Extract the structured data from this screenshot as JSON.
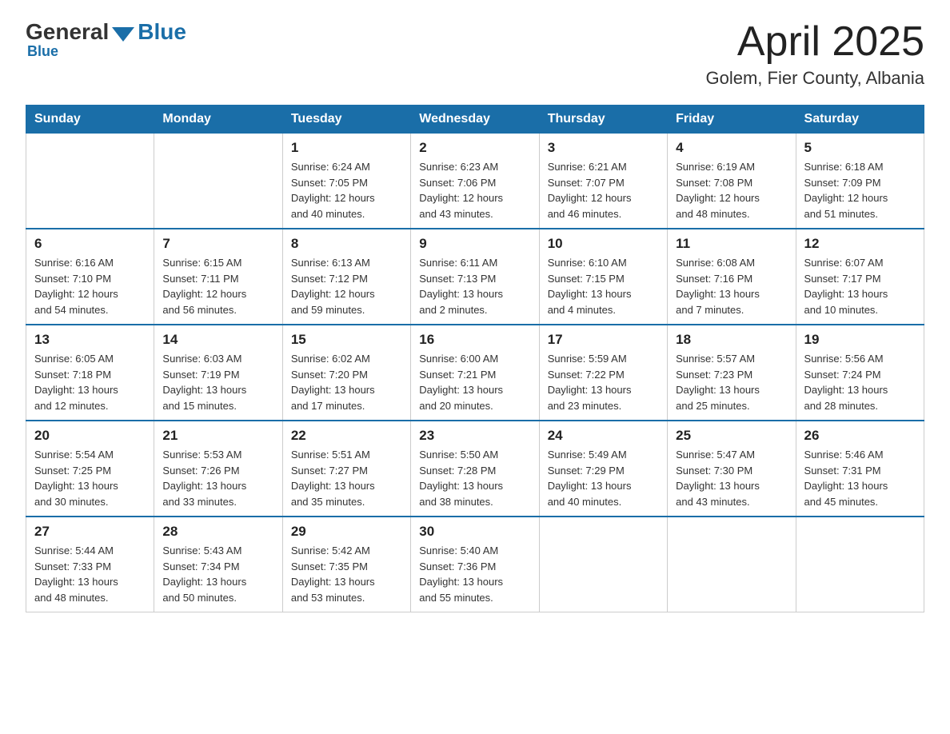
{
  "header": {
    "logo": {
      "general": "General",
      "blue": "Blue"
    },
    "title": "April 2025",
    "location": "Golem, Fier County, Albania"
  },
  "weekdays": [
    "Sunday",
    "Monday",
    "Tuesday",
    "Wednesday",
    "Thursday",
    "Friday",
    "Saturday"
  ],
  "weeks": [
    [
      {
        "day": "",
        "info": ""
      },
      {
        "day": "",
        "info": ""
      },
      {
        "day": "1",
        "info": "Sunrise: 6:24 AM\nSunset: 7:05 PM\nDaylight: 12 hours\nand 40 minutes."
      },
      {
        "day": "2",
        "info": "Sunrise: 6:23 AM\nSunset: 7:06 PM\nDaylight: 12 hours\nand 43 minutes."
      },
      {
        "day": "3",
        "info": "Sunrise: 6:21 AM\nSunset: 7:07 PM\nDaylight: 12 hours\nand 46 minutes."
      },
      {
        "day": "4",
        "info": "Sunrise: 6:19 AM\nSunset: 7:08 PM\nDaylight: 12 hours\nand 48 minutes."
      },
      {
        "day": "5",
        "info": "Sunrise: 6:18 AM\nSunset: 7:09 PM\nDaylight: 12 hours\nand 51 minutes."
      }
    ],
    [
      {
        "day": "6",
        "info": "Sunrise: 6:16 AM\nSunset: 7:10 PM\nDaylight: 12 hours\nand 54 minutes."
      },
      {
        "day": "7",
        "info": "Sunrise: 6:15 AM\nSunset: 7:11 PM\nDaylight: 12 hours\nand 56 minutes."
      },
      {
        "day": "8",
        "info": "Sunrise: 6:13 AM\nSunset: 7:12 PM\nDaylight: 12 hours\nand 59 minutes."
      },
      {
        "day": "9",
        "info": "Sunrise: 6:11 AM\nSunset: 7:13 PM\nDaylight: 13 hours\nand 2 minutes."
      },
      {
        "day": "10",
        "info": "Sunrise: 6:10 AM\nSunset: 7:15 PM\nDaylight: 13 hours\nand 4 minutes."
      },
      {
        "day": "11",
        "info": "Sunrise: 6:08 AM\nSunset: 7:16 PM\nDaylight: 13 hours\nand 7 minutes."
      },
      {
        "day": "12",
        "info": "Sunrise: 6:07 AM\nSunset: 7:17 PM\nDaylight: 13 hours\nand 10 minutes."
      }
    ],
    [
      {
        "day": "13",
        "info": "Sunrise: 6:05 AM\nSunset: 7:18 PM\nDaylight: 13 hours\nand 12 minutes."
      },
      {
        "day": "14",
        "info": "Sunrise: 6:03 AM\nSunset: 7:19 PM\nDaylight: 13 hours\nand 15 minutes."
      },
      {
        "day": "15",
        "info": "Sunrise: 6:02 AM\nSunset: 7:20 PM\nDaylight: 13 hours\nand 17 minutes."
      },
      {
        "day": "16",
        "info": "Sunrise: 6:00 AM\nSunset: 7:21 PM\nDaylight: 13 hours\nand 20 minutes."
      },
      {
        "day": "17",
        "info": "Sunrise: 5:59 AM\nSunset: 7:22 PM\nDaylight: 13 hours\nand 23 minutes."
      },
      {
        "day": "18",
        "info": "Sunrise: 5:57 AM\nSunset: 7:23 PM\nDaylight: 13 hours\nand 25 minutes."
      },
      {
        "day": "19",
        "info": "Sunrise: 5:56 AM\nSunset: 7:24 PM\nDaylight: 13 hours\nand 28 minutes."
      }
    ],
    [
      {
        "day": "20",
        "info": "Sunrise: 5:54 AM\nSunset: 7:25 PM\nDaylight: 13 hours\nand 30 minutes."
      },
      {
        "day": "21",
        "info": "Sunrise: 5:53 AM\nSunset: 7:26 PM\nDaylight: 13 hours\nand 33 minutes."
      },
      {
        "day": "22",
        "info": "Sunrise: 5:51 AM\nSunset: 7:27 PM\nDaylight: 13 hours\nand 35 minutes."
      },
      {
        "day": "23",
        "info": "Sunrise: 5:50 AM\nSunset: 7:28 PM\nDaylight: 13 hours\nand 38 minutes."
      },
      {
        "day": "24",
        "info": "Sunrise: 5:49 AM\nSunset: 7:29 PM\nDaylight: 13 hours\nand 40 minutes."
      },
      {
        "day": "25",
        "info": "Sunrise: 5:47 AM\nSunset: 7:30 PM\nDaylight: 13 hours\nand 43 minutes."
      },
      {
        "day": "26",
        "info": "Sunrise: 5:46 AM\nSunset: 7:31 PM\nDaylight: 13 hours\nand 45 minutes."
      }
    ],
    [
      {
        "day": "27",
        "info": "Sunrise: 5:44 AM\nSunset: 7:33 PM\nDaylight: 13 hours\nand 48 minutes."
      },
      {
        "day": "28",
        "info": "Sunrise: 5:43 AM\nSunset: 7:34 PM\nDaylight: 13 hours\nand 50 minutes."
      },
      {
        "day": "29",
        "info": "Sunrise: 5:42 AM\nSunset: 7:35 PM\nDaylight: 13 hours\nand 53 minutes."
      },
      {
        "day": "30",
        "info": "Sunrise: 5:40 AM\nSunset: 7:36 PM\nDaylight: 13 hours\nand 55 minutes."
      },
      {
        "day": "",
        "info": ""
      },
      {
        "day": "",
        "info": ""
      },
      {
        "day": "",
        "info": ""
      }
    ]
  ]
}
